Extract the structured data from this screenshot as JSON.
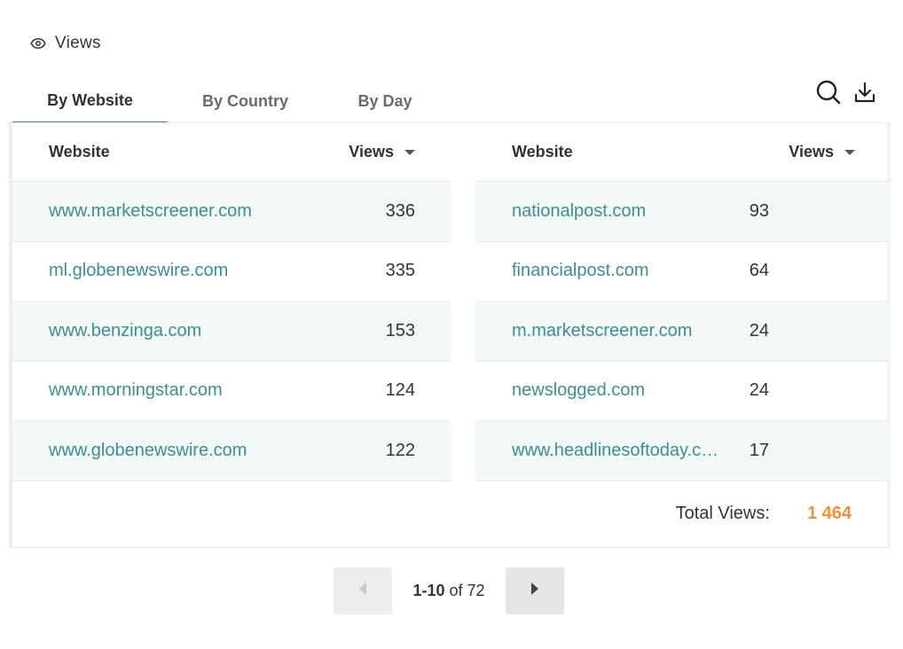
{
  "header": {
    "title": "Views",
    "icon": "eye-icon"
  },
  "tabs": [
    {
      "label": "By Website",
      "active": true
    },
    {
      "label": "By Country",
      "active": false
    },
    {
      "label": "By Day",
      "active": false
    }
  ],
  "toolbar": {
    "search_icon": "search-icon",
    "download_icon": "download-icon"
  },
  "table_left": {
    "headers": {
      "website": "Website",
      "views": "Views"
    },
    "rows": [
      {
        "site": "www.marketscreener.com",
        "views": "336"
      },
      {
        "site": "ml.globenewswire.com",
        "views": "335"
      },
      {
        "site": "www.benzinga.com",
        "views": "153"
      },
      {
        "site": "www.morningstar.com",
        "views": "124"
      },
      {
        "site": "www.globenewswire.com",
        "views": "122"
      }
    ]
  },
  "table_right": {
    "headers": {
      "website": "Website",
      "views": "Views"
    },
    "rows": [
      {
        "site": "nationalpost.com",
        "views": "93"
      },
      {
        "site": "financialpost.com",
        "views": "64"
      },
      {
        "site": "m.marketscreener.com",
        "views": "24"
      },
      {
        "site": "newslogged.com",
        "views": "24"
      },
      {
        "site": "www.headlinesoftoday.c…",
        "views": "17"
      }
    ]
  },
  "total": {
    "label": "Total Views:",
    "value": "1 464"
  },
  "pagination": {
    "range": "1-10",
    "of_text": "of 72"
  },
  "colors": {
    "accent": "#3d8f8f",
    "total": "#f0913a",
    "row_alt": "#f2f7f7"
  }
}
